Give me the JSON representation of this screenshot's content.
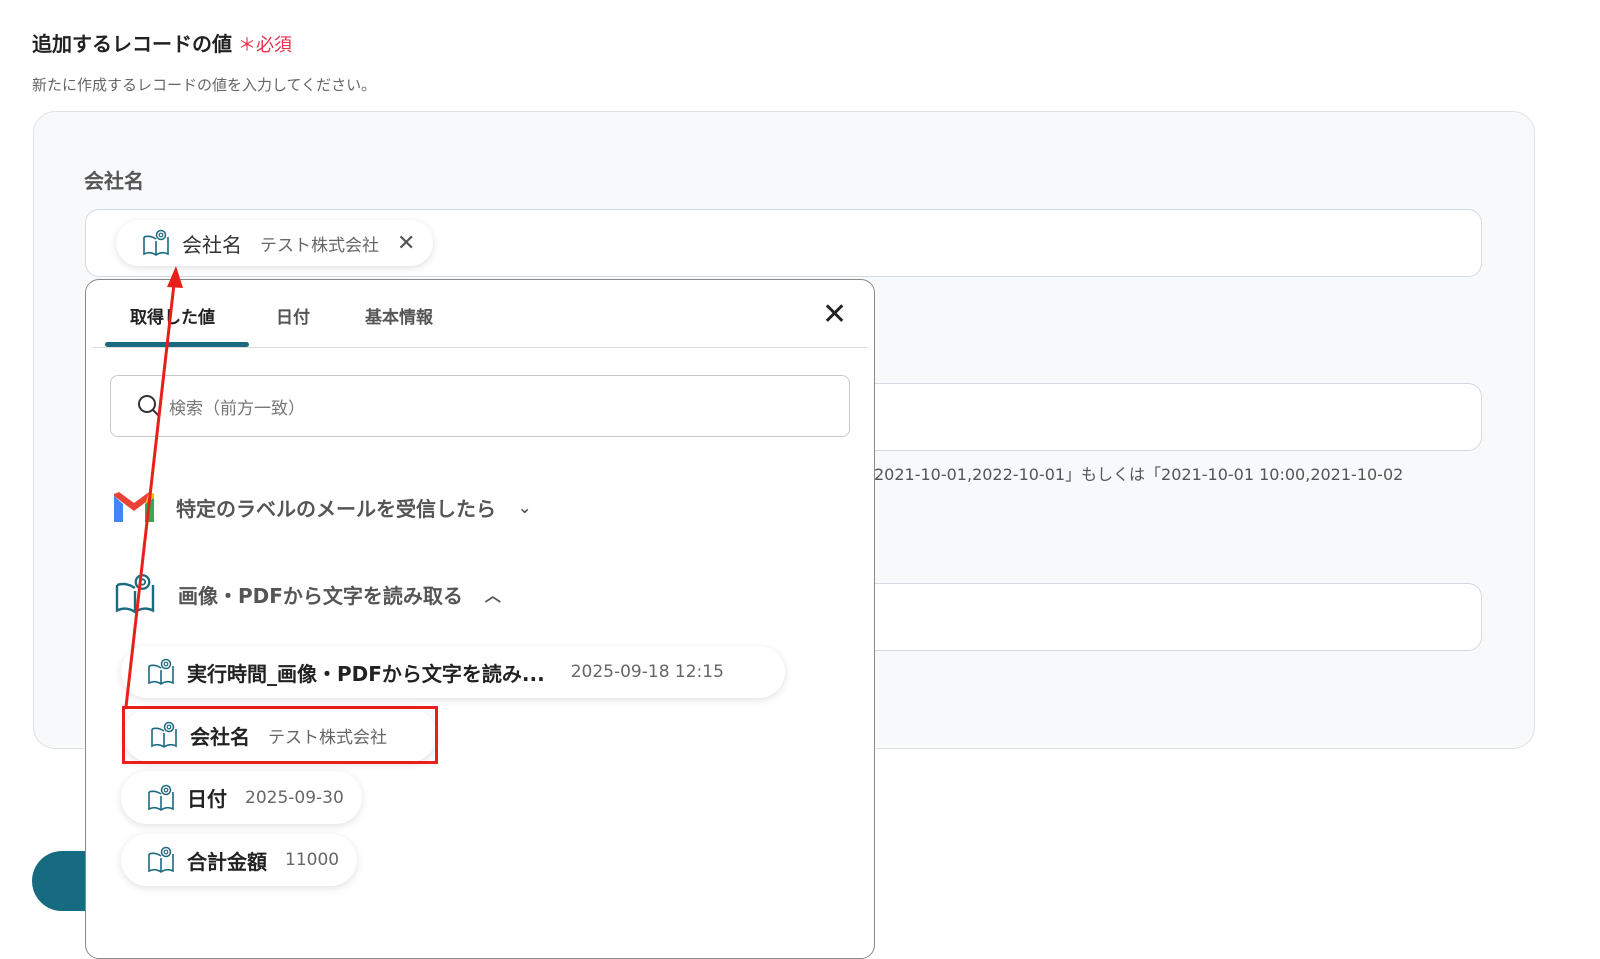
{
  "section": {
    "title": "追加するレコードの値",
    "required_mark": "＊",
    "required_label": "必須",
    "description": "新たに作成するレコードの値を入力してください。"
  },
  "field": {
    "label": "会社名",
    "chip": {
      "key": "会社名",
      "value": "テスト株式会社"
    }
  },
  "hint": "「2021-10-01,2022-10-01」もしくは「2021-10-01 10:00,2021-10-02",
  "popup": {
    "tabs": [
      {
        "label": "取得した値"
      },
      {
        "label": "日付"
      },
      {
        "label": "基本情報"
      }
    ],
    "search_placeholder": "検索（前方一致）",
    "groups": [
      {
        "label": "特定のラベルのメールを受信したら",
        "icon": "gmail-icon",
        "expanded": false
      },
      {
        "label": "画像・PDFから文字を読み取る",
        "icon": "ocr-book-icon",
        "expanded": true
      }
    ],
    "items": [
      {
        "key": "実行時間_画像・PDFから文字を読み...",
        "value": "2025-09-18 12:15"
      },
      {
        "key": "会社名",
        "value": "テスト株式会社"
      },
      {
        "key": "日付",
        "value": "2025-09-30"
      },
      {
        "key": "合計金額",
        "value": "11000"
      }
    ]
  },
  "colors": {
    "accent": "#1b6a80",
    "required": "#e8304a",
    "highlight": "#e8201a"
  }
}
